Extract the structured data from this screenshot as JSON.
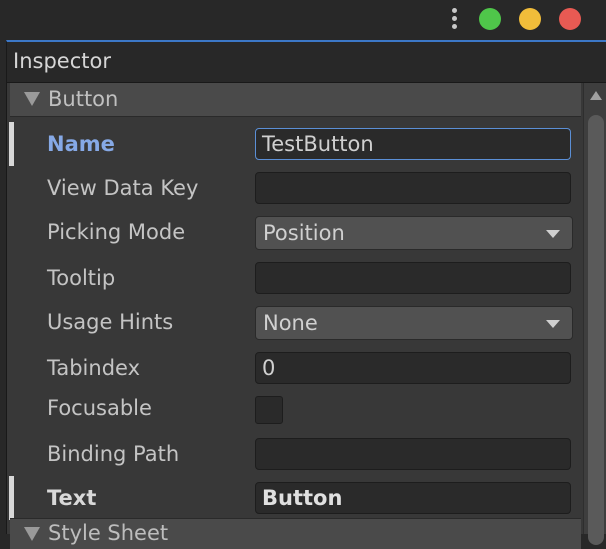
{
  "window": {
    "controls": {
      "close_color": "#e85a53",
      "minimize_color": "#f1bd3a",
      "maximize_color": "#4fc64a"
    }
  },
  "inspector": {
    "title": "Inspector",
    "section": "Button",
    "next_section": "Style Sheet",
    "fields": {
      "name": {
        "label": "Name",
        "value": "TestButton"
      },
      "view_data_key": {
        "label": "View Data Key",
        "value": ""
      },
      "picking_mode": {
        "label": "Picking Mode",
        "value": "Position"
      },
      "tooltip": {
        "label": "Tooltip",
        "value": ""
      },
      "usage_hints": {
        "label": "Usage Hints",
        "value": "None"
      },
      "tabindex": {
        "label": "Tabindex",
        "value": "0"
      },
      "focusable": {
        "label": "Focusable",
        "checked": false
      },
      "binding_path": {
        "label": "Binding Path",
        "value": ""
      },
      "text": {
        "label": "Text",
        "value": "Button"
      }
    }
  },
  "colors": {
    "accent": "#5b8fd6",
    "active_label": "#86a9e6"
  }
}
